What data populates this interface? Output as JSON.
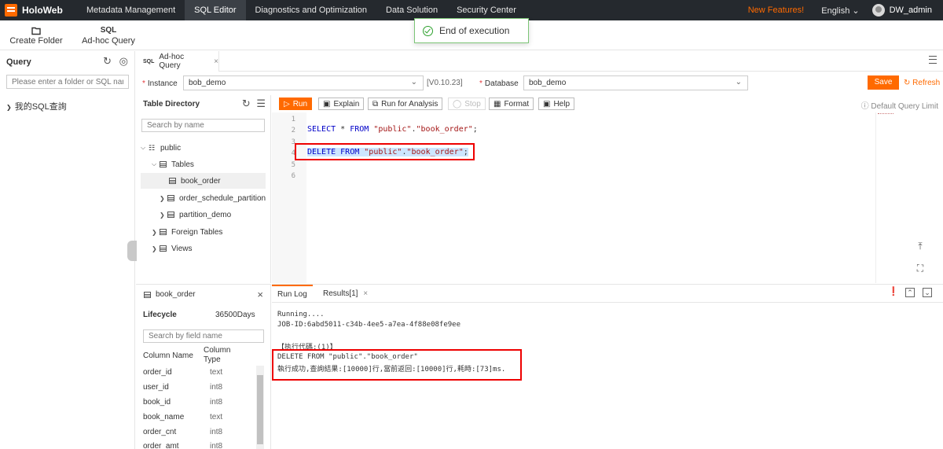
{
  "app": {
    "name": "HoloWeb"
  },
  "nav": {
    "items": [
      "Metadata Management",
      "SQL Editor",
      "Diagnostics and Optimization",
      "Data Solution",
      "Security Center"
    ],
    "new_features": "New Features!",
    "language": "English",
    "user": "DW_admin"
  },
  "toast": {
    "message": "End of execution"
  },
  "subbar": {
    "create_folder": "Create Folder",
    "adhoc_query": "Ad-hoc Query",
    "sql_icon_text": "SQL"
  },
  "left": {
    "title": "Query",
    "search_placeholder": "Please enter a folder or SQL name",
    "my_sql": "我的SQL查詢"
  },
  "tab": {
    "sql_tag": "SQL",
    "label": "Ad-hoc Query"
  },
  "instance": {
    "label": "Instance",
    "value": "bob_demo",
    "version": "[V0.10.23]",
    "db_label": "Database",
    "db_value": "bob_demo",
    "save": "Save",
    "refresh": "Refresh"
  },
  "table_dir": {
    "title": "Table Directory",
    "search_placeholder": "Search by name",
    "schema": "public",
    "tables_group": "Tables",
    "tables": [
      "book_order",
      "order_schedule_partition",
      "partition_demo"
    ],
    "foreign_tables": "Foreign Tables",
    "views": "Views"
  },
  "toolbar": {
    "run": "Run",
    "explain": "Explain",
    "run_analysis": "Run for Analysis",
    "stop": "Stop",
    "format": "Format",
    "help": "Help",
    "default_limit": "Default Query Limit"
  },
  "editor": {
    "line_numbers": [
      "1",
      "2",
      "3",
      "4",
      "5",
      "6"
    ],
    "line2": {
      "kw1": "SELECT",
      "op": " * ",
      "kw2": "FROM",
      "str1": "\"public\"",
      "dot": ".",
      "str2": "\"book_order\"",
      "end": ";"
    },
    "line4": {
      "kw1": "DELETE",
      "kw2": "FROM",
      "str1": "\"public\"",
      "dot": ".",
      "str2": "\"book_order\"",
      "end": ";"
    }
  },
  "table_detail": {
    "name": "book_order",
    "lifecycle_label": "Lifecycle",
    "lifecycle_value": "36500Days",
    "search_placeholder": "Search by field name",
    "col_name_header": "Column Name",
    "col_type_header_1": "Column",
    "col_type_header_2": "Type",
    "columns": [
      {
        "name": "order_id",
        "type": "text"
      },
      {
        "name": "user_id",
        "type": "int8"
      },
      {
        "name": "book_id",
        "type": "int8"
      },
      {
        "name": "book_name",
        "type": "text"
      },
      {
        "name": "order_cnt",
        "type": "int8"
      },
      {
        "name": "order_amt",
        "type": "int8"
      }
    ]
  },
  "log": {
    "tab_runlog": "Run Log",
    "tab_results": "Results[1]",
    "running": "Running....",
    "job_id": "JOB-ID:6abd5011-c34b-4ee5-a7ea-4f88e08fe9ee",
    "exec_code": "【执行代碼:(1)】",
    "stmt": "DELETE FROM \"public\".\"book_order\"",
    "result": "執行成功,查詢結果:[10000]行,當前返回:[10000]行,耗時:[73]ms."
  }
}
